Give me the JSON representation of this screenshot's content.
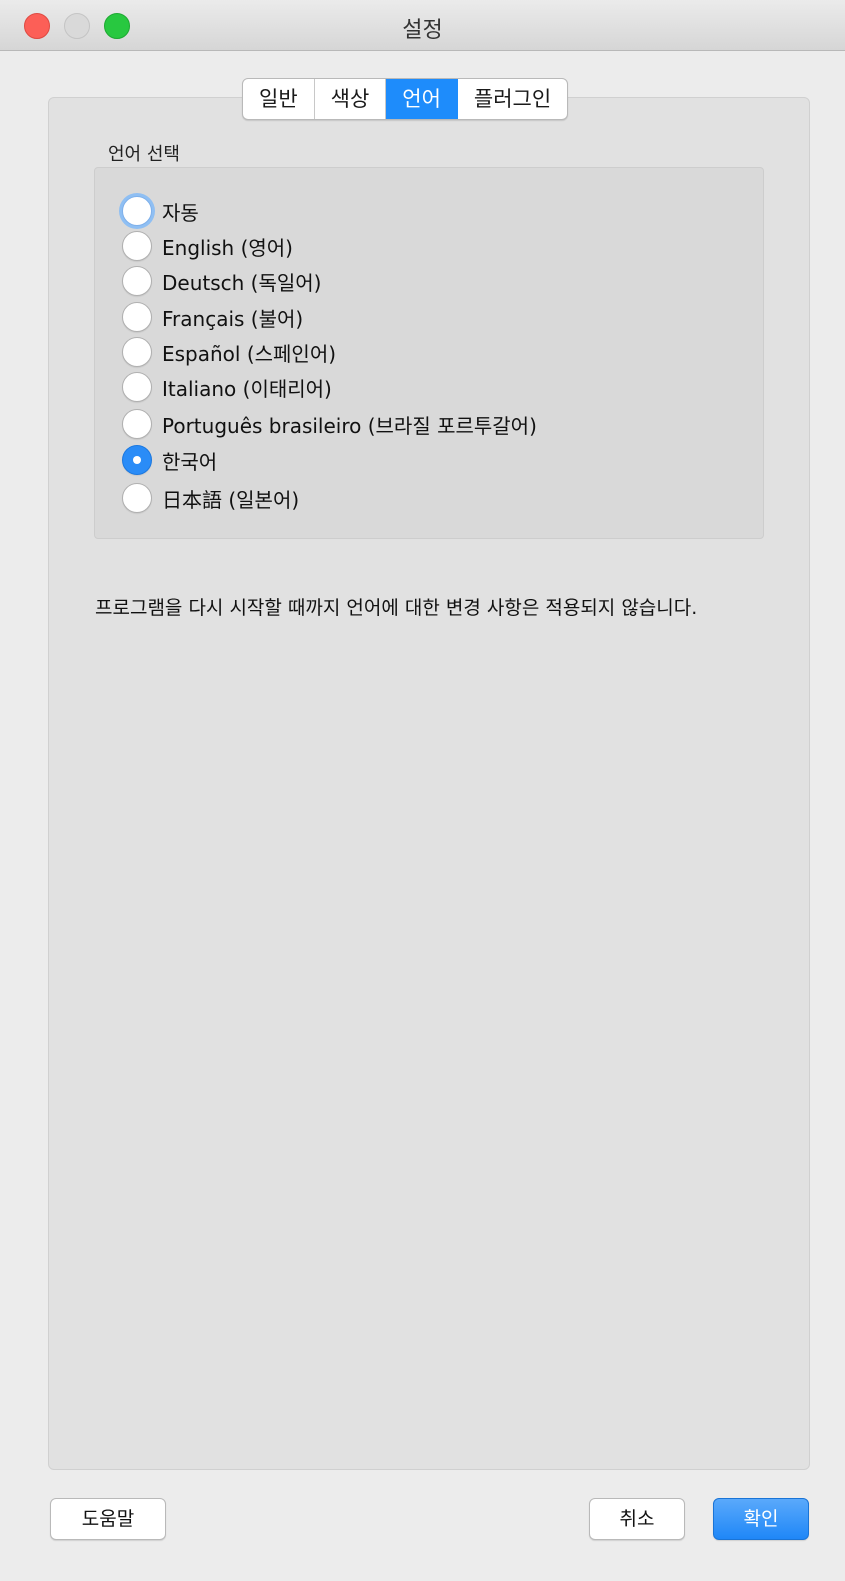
{
  "window": {
    "title": "설정"
  },
  "tabs": [
    {
      "label": "일반"
    },
    {
      "label": "색상"
    },
    {
      "label": "언어",
      "active": true
    },
    {
      "label": "플러그인"
    }
  ],
  "language": {
    "group_label": "언어 선택",
    "options": [
      {
        "label": "자동",
        "checked": false
      },
      {
        "label": "English (영어)",
        "checked": false
      },
      {
        "label": "Deutsch (독일어)",
        "checked": false
      },
      {
        "label": "Français (불어)",
        "checked": false
      },
      {
        "label": "Español (스페인어)",
        "checked": false
      },
      {
        "label": "Italiano (이태리어)",
        "checked": false
      },
      {
        "label": "Português brasileiro (브라질 포르투갈어)",
        "checked": false
      },
      {
        "label": "한국어",
        "checked": true
      },
      {
        "label": "日本語 (일본어)",
        "checked": false
      }
    ],
    "note": "프로그램을 다시 시작할 때까지 언어에 대한 변경 사항은 적용되지 않습니다."
  },
  "buttons": {
    "help": "도움말",
    "cancel": "취소",
    "ok": "확인"
  },
  "colors": {
    "accent": "#1e8cfb",
    "close": "#fc5f57",
    "minimize": "#d9d9d9",
    "maximize": "#28c840"
  }
}
